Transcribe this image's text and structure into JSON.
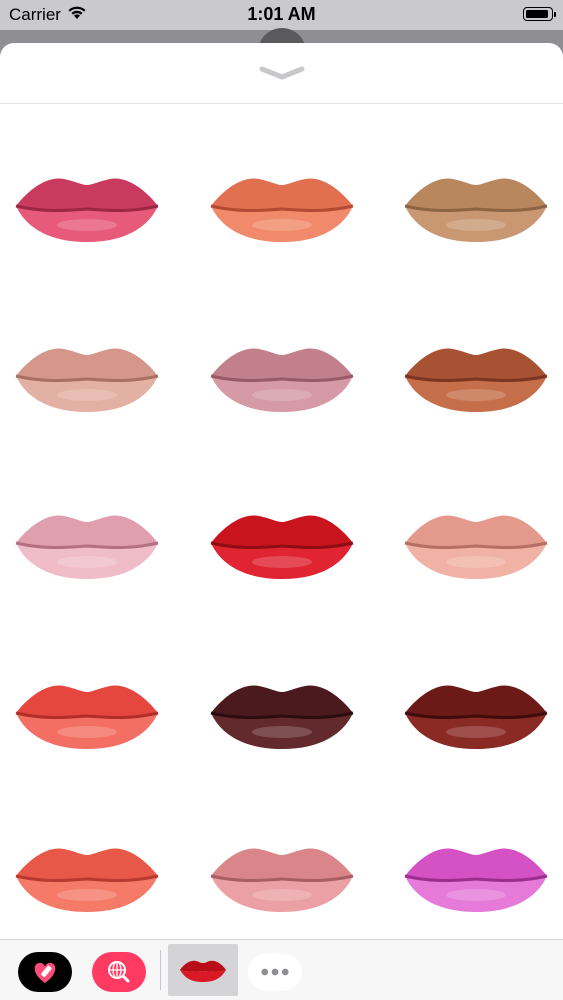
{
  "status_bar": {
    "carrier": "Carrier",
    "time": "1:01 AM",
    "icons": [
      "wifi-icon",
      "battery-icon"
    ]
  },
  "sheet": {
    "grabber_icon": "chevron-down-icon"
  },
  "stickers": [
    {
      "name": "lips-sticker",
      "upper": "#c93a5e",
      "lower": "#e85a7a",
      "line": "#9c2745"
    },
    {
      "name": "lips-sticker",
      "upper": "#e0704f",
      "lower": "#f08a6a",
      "line": "#b44a34"
    },
    {
      "name": "lips-sticker",
      "upper": "#b9875e",
      "lower": "#c99873",
      "line": "#8c6444"
    },
    {
      "name": "lips-sticker",
      "upper": "#d4978a",
      "lower": "#e3b0a4",
      "line": "#a96f62"
    },
    {
      "name": "lips-sticker",
      "upper": "#c2808d",
      "lower": "#d59aa6",
      "line": "#975a66"
    },
    {
      "name": "lips-sticker",
      "upper": "#a65233",
      "lower": "#c46f4a",
      "line": "#7a3621"
    },
    {
      "name": "lips-sticker",
      "upper": "#df9fae",
      "lower": "#efbcc8",
      "line": "#b47080"
    },
    {
      "name": "lips-sticker",
      "upper": "#c9141e",
      "lower": "#e02431",
      "line": "#8e0c14"
    },
    {
      "name": "lips-sticker",
      "upper": "#e39a8c",
      "lower": "#f0b2a5",
      "line": "#b66f62"
    },
    {
      "name": "lips-sticker",
      "upper": "#e5473f",
      "lower": "#f46f63",
      "line": "#b22d27"
    },
    {
      "name": "lips-sticker",
      "upper": "#4a1a1e",
      "lower": "#632a2e",
      "line": "#2b0c0f"
    },
    {
      "name": "lips-sticker",
      "upper": "#6b1a17",
      "lower": "#8a2a25",
      "line": "#3f0c0b"
    },
    {
      "name": "lips-sticker",
      "upper": "#e85848",
      "lower": "#f57a68",
      "line": "#b83a2e"
    },
    {
      "name": "lips-sticker",
      "upper": "#d9858a",
      "lower": "#eba0a5",
      "line": "#aa5e63"
    },
    {
      "name": "lips-sticker",
      "upper": "#d452c4",
      "lower": "#e57ad8",
      "line": "#9c2e8e"
    }
  ],
  "tabbar": {
    "apps": [
      {
        "name": "heart-sticker-app-icon",
        "bg": "#000000",
        "glyph": "#ff4d7a"
      },
      {
        "name": "search-images-app-icon",
        "bg": "#ff3b63",
        "glyph": "#ffffff"
      },
      {
        "name": "lips-sticker-app-icon",
        "bg": "#d4d4d6",
        "glyph": "#d01020"
      },
      {
        "name": "more-apps-icon",
        "bg": "#ffffff",
        "glyph": "#8e8e93"
      }
    ]
  }
}
